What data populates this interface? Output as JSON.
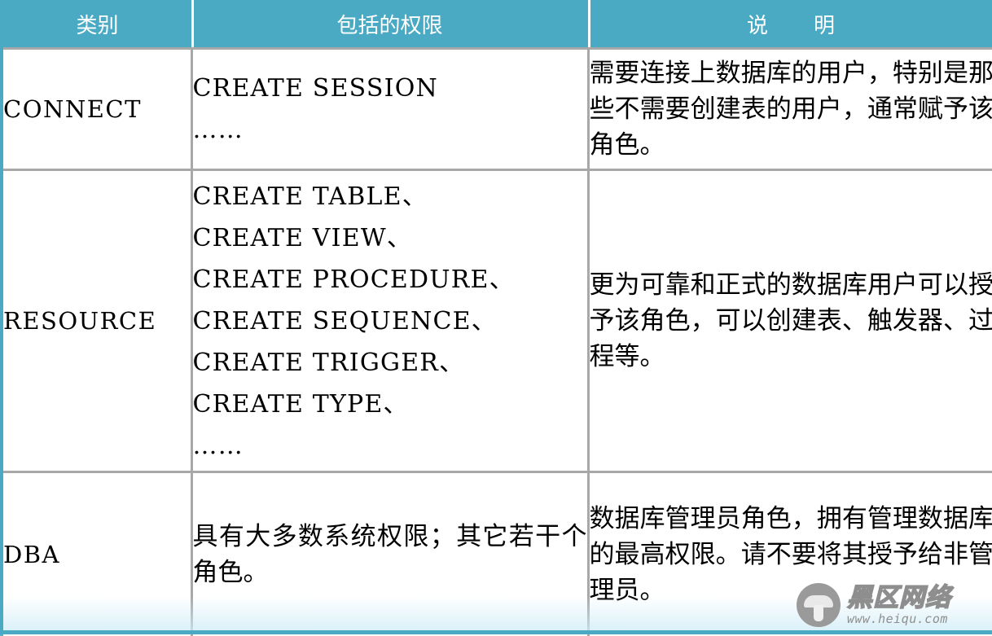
{
  "table": {
    "headers": {
      "category": "类别",
      "privileges": "包括的权限",
      "description_left": "说",
      "description_right": "明"
    },
    "rows": [
      {
        "category": "CONNECT",
        "privileges": [
          "CREATE SESSION",
          "……"
        ],
        "description": "需要连接上数据库的用户，特别是那些不需要创建表的用户，通常赋予该角色。"
      },
      {
        "category": "RESOURCE",
        "privileges": [
          "CREATE TABLE、",
          "CREATE VIEW、",
          "CREATE PROCEDURE、",
          "CREATE SEQUENCE、",
          "CREATE TRIGGER、",
          "CREATE TYPE、",
          "……"
        ],
        "description": "更为可靠和正式的数据库用户可以授予该角色，可以创建表、触发器、过程等。"
      },
      {
        "category": "DBA",
        "privileges": [
          "具有大多数系统权限；其它若干个角色。"
        ],
        "description": "数据库管理员角色，拥有管理数据库的最高权限。请不要将其授予给非管理员。"
      }
    ]
  },
  "watermark": {
    "name": "黑区网络",
    "url": "www.heiqu.com"
  },
  "colors": {
    "header_bg": "#4aaac4",
    "header_text": "#ffffff",
    "grid_line": "#a8a8a8",
    "body_text": "#000000",
    "accent_rule": "#4aaac4",
    "watermark_gray": "#8e8e8e"
  }
}
